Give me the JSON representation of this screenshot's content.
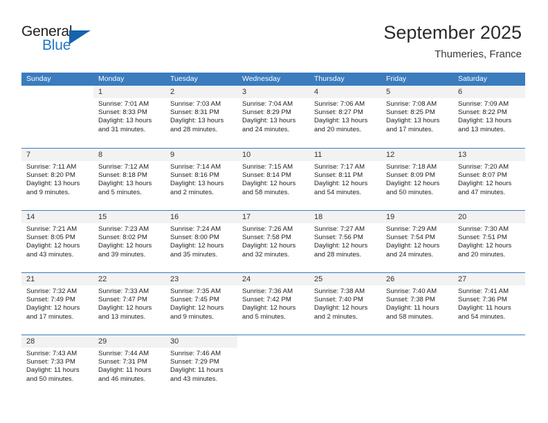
{
  "brand": {
    "name_part1": "General",
    "name_part2": "Blue",
    "triangle_icon": "triangle-icon"
  },
  "header": {
    "title": "September 2025",
    "subtitle": "Thumeries, France"
  },
  "colors": {
    "header_blue": "#3a7cbe",
    "daynum_band": "#f2f2f2",
    "brand_dark": "#231f20",
    "brand_blue": "#2277c8",
    "triangle_blue": "#1464ac"
  },
  "weekdays": [
    "Sunday",
    "Monday",
    "Tuesday",
    "Wednesday",
    "Thursday",
    "Friday",
    "Saturday"
  ],
  "weeks": [
    [
      {
        "day": "",
        "sunrise": "",
        "sunset": "",
        "daylight_line1": "",
        "daylight_line2": ""
      },
      {
        "day": "1",
        "sunrise": "Sunrise: 7:01 AM",
        "sunset": "Sunset: 8:33 PM",
        "daylight_line1": "Daylight: 13 hours",
        "daylight_line2": "and 31 minutes."
      },
      {
        "day": "2",
        "sunrise": "Sunrise: 7:03 AM",
        "sunset": "Sunset: 8:31 PM",
        "daylight_line1": "Daylight: 13 hours",
        "daylight_line2": "and 28 minutes."
      },
      {
        "day": "3",
        "sunrise": "Sunrise: 7:04 AM",
        "sunset": "Sunset: 8:29 PM",
        "daylight_line1": "Daylight: 13 hours",
        "daylight_line2": "and 24 minutes."
      },
      {
        "day": "4",
        "sunrise": "Sunrise: 7:06 AM",
        "sunset": "Sunset: 8:27 PM",
        "daylight_line1": "Daylight: 13 hours",
        "daylight_line2": "and 20 minutes."
      },
      {
        "day": "5",
        "sunrise": "Sunrise: 7:08 AM",
        "sunset": "Sunset: 8:25 PM",
        "daylight_line1": "Daylight: 13 hours",
        "daylight_line2": "and 17 minutes."
      },
      {
        "day": "6",
        "sunrise": "Sunrise: 7:09 AM",
        "sunset": "Sunset: 8:22 PM",
        "daylight_line1": "Daylight: 13 hours",
        "daylight_line2": "and 13 minutes."
      }
    ],
    [
      {
        "day": "7",
        "sunrise": "Sunrise: 7:11 AM",
        "sunset": "Sunset: 8:20 PM",
        "daylight_line1": "Daylight: 13 hours",
        "daylight_line2": "and 9 minutes."
      },
      {
        "day": "8",
        "sunrise": "Sunrise: 7:12 AM",
        "sunset": "Sunset: 8:18 PM",
        "daylight_line1": "Daylight: 13 hours",
        "daylight_line2": "and 5 minutes."
      },
      {
        "day": "9",
        "sunrise": "Sunrise: 7:14 AM",
        "sunset": "Sunset: 8:16 PM",
        "daylight_line1": "Daylight: 13 hours",
        "daylight_line2": "and 2 minutes."
      },
      {
        "day": "10",
        "sunrise": "Sunrise: 7:15 AM",
        "sunset": "Sunset: 8:14 PM",
        "daylight_line1": "Daylight: 12 hours",
        "daylight_line2": "and 58 minutes."
      },
      {
        "day": "11",
        "sunrise": "Sunrise: 7:17 AM",
        "sunset": "Sunset: 8:11 PM",
        "daylight_line1": "Daylight: 12 hours",
        "daylight_line2": "and 54 minutes."
      },
      {
        "day": "12",
        "sunrise": "Sunrise: 7:18 AM",
        "sunset": "Sunset: 8:09 PM",
        "daylight_line1": "Daylight: 12 hours",
        "daylight_line2": "and 50 minutes."
      },
      {
        "day": "13",
        "sunrise": "Sunrise: 7:20 AM",
        "sunset": "Sunset: 8:07 PM",
        "daylight_line1": "Daylight: 12 hours",
        "daylight_line2": "and 47 minutes."
      }
    ],
    [
      {
        "day": "14",
        "sunrise": "Sunrise: 7:21 AM",
        "sunset": "Sunset: 8:05 PM",
        "daylight_line1": "Daylight: 12 hours",
        "daylight_line2": "and 43 minutes."
      },
      {
        "day": "15",
        "sunrise": "Sunrise: 7:23 AM",
        "sunset": "Sunset: 8:02 PM",
        "daylight_line1": "Daylight: 12 hours",
        "daylight_line2": "and 39 minutes."
      },
      {
        "day": "16",
        "sunrise": "Sunrise: 7:24 AM",
        "sunset": "Sunset: 8:00 PM",
        "daylight_line1": "Daylight: 12 hours",
        "daylight_line2": "and 35 minutes."
      },
      {
        "day": "17",
        "sunrise": "Sunrise: 7:26 AM",
        "sunset": "Sunset: 7:58 PM",
        "daylight_line1": "Daylight: 12 hours",
        "daylight_line2": "and 32 minutes."
      },
      {
        "day": "18",
        "sunrise": "Sunrise: 7:27 AM",
        "sunset": "Sunset: 7:56 PM",
        "daylight_line1": "Daylight: 12 hours",
        "daylight_line2": "and 28 minutes."
      },
      {
        "day": "19",
        "sunrise": "Sunrise: 7:29 AM",
        "sunset": "Sunset: 7:54 PM",
        "daylight_line1": "Daylight: 12 hours",
        "daylight_line2": "and 24 minutes."
      },
      {
        "day": "20",
        "sunrise": "Sunrise: 7:30 AM",
        "sunset": "Sunset: 7:51 PM",
        "daylight_line1": "Daylight: 12 hours",
        "daylight_line2": "and 20 minutes."
      }
    ],
    [
      {
        "day": "21",
        "sunrise": "Sunrise: 7:32 AM",
        "sunset": "Sunset: 7:49 PM",
        "daylight_line1": "Daylight: 12 hours",
        "daylight_line2": "and 17 minutes."
      },
      {
        "day": "22",
        "sunrise": "Sunrise: 7:33 AM",
        "sunset": "Sunset: 7:47 PM",
        "daylight_line1": "Daylight: 12 hours",
        "daylight_line2": "and 13 minutes."
      },
      {
        "day": "23",
        "sunrise": "Sunrise: 7:35 AM",
        "sunset": "Sunset: 7:45 PM",
        "daylight_line1": "Daylight: 12 hours",
        "daylight_line2": "and 9 minutes."
      },
      {
        "day": "24",
        "sunrise": "Sunrise: 7:36 AM",
        "sunset": "Sunset: 7:42 PM",
        "daylight_line1": "Daylight: 12 hours",
        "daylight_line2": "and 5 minutes."
      },
      {
        "day": "25",
        "sunrise": "Sunrise: 7:38 AM",
        "sunset": "Sunset: 7:40 PM",
        "daylight_line1": "Daylight: 12 hours",
        "daylight_line2": "and 2 minutes."
      },
      {
        "day": "26",
        "sunrise": "Sunrise: 7:40 AM",
        "sunset": "Sunset: 7:38 PM",
        "daylight_line1": "Daylight: 11 hours",
        "daylight_line2": "and 58 minutes."
      },
      {
        "day": "27",
        "sunrise": "Sunrise: 7:41 AM",
        "sunset": "Sunset: 7:36 PM",
        "daylight_line1": "Daylight: 11 hours",
        "daylight_line2": "and 54 minutes."
      }
    ],
    [
      {
        "day": "28",
        "sunrise": "Sunrise: 7:43 AM",
        "sunset": "Sunset: 7:33 PM",
        "daylight_line1": "Daylight: 11 hours",
        "daylight_line2": "and 50 minutes."
      },
      {
        "day": "29",
        "sunrise": "Sunrise: 7:44 AM",
        "sunset": "Sunset: 7:31 PM",
        "daylight_line1": "Daylight: 11 hours",
        "daylight_line2": "and 46 minutes."
      },
      {
        "day": "30",
        "sunrise": "Sunrise: 7:46 AM",
        "sunset": "Sunset: 7:29 PM",
        "daylight_line1": "Daylight: 11 hours",
        "daylight_line2": "and 43 minutes."
      },
      {
        "day": "",
        "sunrise": "",
        "sunset": "",
        "daylight_line1": "",
        "daylight_line2": ""
      },
      {
        "day": "",
        "sunrise": "",
        "sunset": "",
        "daylight_line1": "",
        "daylight_line2": ""
      },
      {
        "day": "",
        "sunrise": "",
        "sunset": "",
        "daylight_line1": "",
        "daylight_line2": ""
      },
      {
        "day": "",
        "sunrise": "",
        "sunset": "",
        "daylight_line1": "",
        "daylight_line2": ""
      }
    ]
  ]
}
